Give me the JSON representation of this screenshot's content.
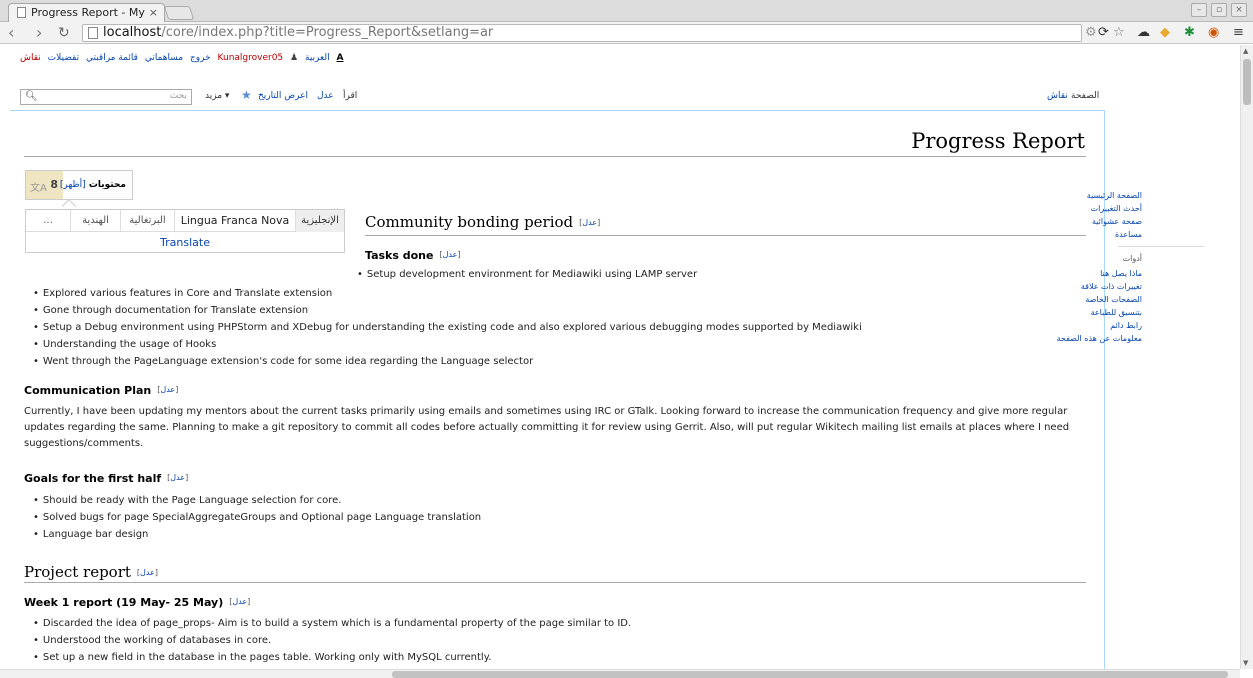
{
  "browser": {
    "tab_title": "Progress Report - My ",
    "tab_close": "×",
    "url_host": "localhost",
    "url_path": "/core/index.php?title=Progress_Report&setlang=ar"
  },
  "personal": {
    "items": [
      "خروج",
      "مساهماتي",
      "قائمة مراقبتي",
      "تفضيلات",
      "نقاش",
      "Kunalgrover05",
      "العربية"
    ],
    "lang_icon": "A"
  },
  "tabs": {
    "page": "الصفحة",
    "talk": "نقاش",
    "read": "اقرأ",
    "edit": "عدل",
    "history": "اعرض التاريخ",
    "more": "مزيد",
    "search_placeholder": "بحث"
  },
  "title": "Progress Report",
  "toc": {
    "count": "8",
    "label": "محتويات",
    "toggle": "[أظهر]"
  },
  "langbar": {
    "languages": [
      "الإنجليزية",
      "Lingua Franca Nova",
      "البرتغالية",
      "الهندية",
      "..."
    ],
    "translate": "Translate"
  },
  "edit_label": "عدل",
  "sections": {
    "community": {
      "title": "Community bonding period",
      "tasks_title": "Tasks done",
      "tasks": [
        "Setup development environment for Mediawiki using LAMP server",
        "Explored various features in Core and Translate extension",
        "Gone through documentation for Translate extension",
        "Setup a Debug environment using PHPStorm and XDebug for understanding the existing code and also explored various debugging modes supported by Mediawiki",
        "Understanding the usage of Hooks",
        "Went through the PageLanguage extension's code for some idea regarding the Language selector"
      ],
      "comm_title": "Communication Plan",
      "comm_text": "Currently, I have been updating my mentors about the current tasks primarily using emails and sometimes using IRC or GTalk. Looking forward to increase the communication frequency and give more regular updates regarding the same. Planning to make a git repository to commit all codes before actually committing it for review using Gerrit. Also, will put regular Wikitech mailing list emails at places where I need suggestions/comments.",
      "goals_title": "Goals for the first half",
      "goals": [
        "Should be ready with the Page Language selection for core.",
        "Solved bugs for page SpecialAggregateGroups and Optional page Language translation",
        "Language bar design"
      ]
    },
    "project": {
      "title": "Project report",
      "week1_title": "Week 1 report (19 May- 25 May)",
      "week1": [
        "Discarded the idea of page_props- Aim is to build a system which is a fundamental property of the page similar to ID.",
        "Understood the working of databases in core.",
        "Set up a new field in the database in the pages table. Working only with MySQL currently."
      ]
    }
  },
  "sidebar": {
    "nav": [
      "الصفحة الرئيسية",
      "أحدث التغييرات",
      "صفحة عشوائية",
      "مساعدة"
    ],
    "tools_title": "أدوات",
    "tools": [
      "ماذا يصل هنا",
      "تغييرات ذات علاقة",
      "الصفحات الخاصة",
      "بتنسيق للطباعة",
      "رابط دائم",
      "معلومات عن هذه الصفحة"
    ]
  }
}
